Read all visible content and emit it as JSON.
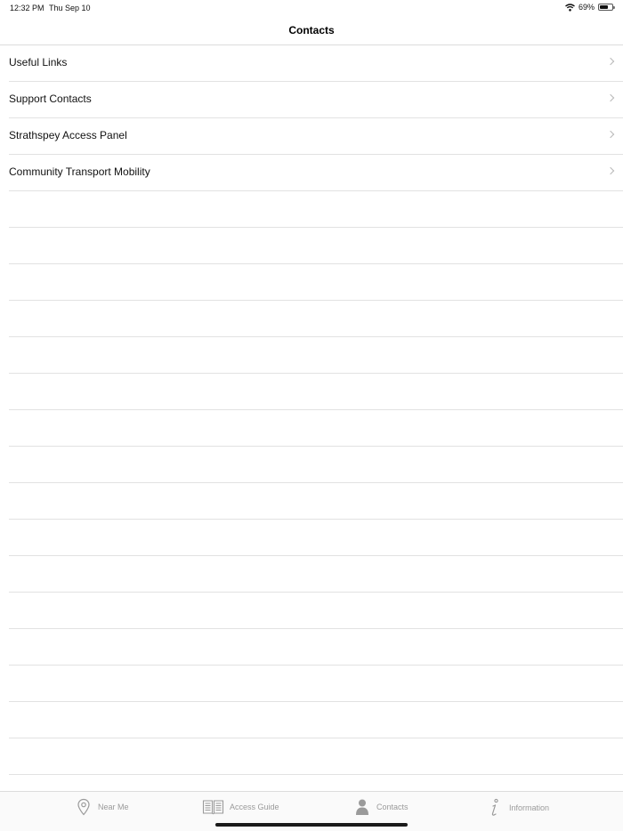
{
  "status": {
    "time": "12:32 PM",
    "date": "Thu Sep 10",
    "battery": "69%",
    "battery_level": 0.69
  },
  "nav": {
    "title": "Contacts"
  },
  "rows": [
    {
      "label": "Useful Links"
    },
    {
      "label": "Support Contacts"
    },
    {
      "label": "Strathspey Access Panel"
    },
    {
      "label": "Community Transport Mobility"
    }
  ],
  "tabs": [
    {
      "label": "Near Me",
      "icon": "location-pin-icon"
    },
    {
      "label": "Access Guide",
      "icon": "book-icon"
    },
    {
      "label": "Contacts",
      "icon": "person-icon",
      "selected": true
    },
    {
      "label": "Information",
      "icon": "info-icon"
    }
  ]
}
